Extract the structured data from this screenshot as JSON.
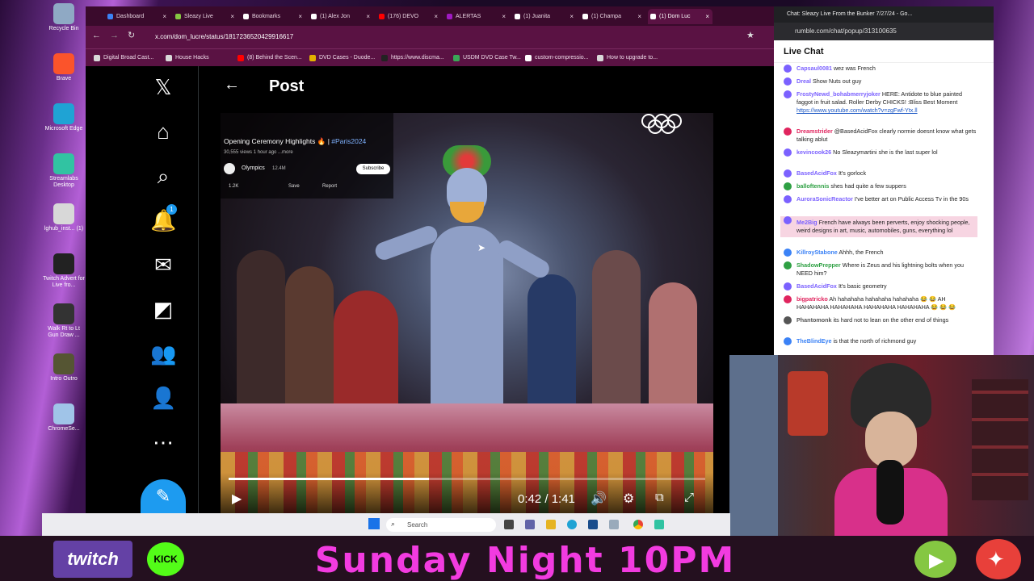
{
  "desktop_icons": [
    {
      "label": "Recycle Bin",
      "color": "#8fa9c4"
    },
    {
      "label": "Brave",
      "color": "#fb542b"
    },
    {
      "label": "Microsoft Edge",
      "color": "#1fa3d4"
    },
    {
      "label": "Streamlabs Desktop",
      "color": "#31c3a2"
    },
    {
      "label": "lghub_inst... (1)",
      "color": "#d8d8d8"
    },
    {
      "label": "Twitch Advert for Live fro...",
      "color": "#222"
    },
    {
      "label": "Walk Rt to Lt Gun Draw ...",
      "color": "#333"
    },
    {
      "label": "Intro Outro",
      "color": "#553"
    },
    {
      "label": "ChromeSe...",
      "color": "#a0c4e8"
    }
  ],
  "browser": {
    "tabs": [
      {
        "label": "Dashboard",
        "color": "#3b82f6"
      },
      {
        "label": "Sleazy Live",
        "color": "#85c742"
      },
      {
        "label": "Bookmarks",
        "color": "#ffffff"
      },
      {
        "label": "(1) Alex Jon",
        "color": "#ffffff"
      },
      {
        "label": "(176) DEVO",
        "color": "#ff0000"
      },
      {
        "label": "ALERTAS",
        "color": "#9f1ac2"
      },
      {
        "label": "(1) Juanita",
        "color": "#ffffff"
      },
      {
        "label": "(1) Champa",
        "color": "#ffffff"
      },
      {
        "label": "(1) Dom Luc",
        "color": "#ffffff"
      }
    ],
    "url": "x.com/dom_lucre/status/1817236520429916617",
    "bookmarks": [
      {
        "label": "Digital Broad Cast...",
        "color": "#d9d9d9"
      },
      {
        "label": "House Hacks",
        "color": "#d9d9d9"
      },
      {
        "label": "(8) Behind the Scen...",
        "color": "#ff0000"
      },
      {
        "label": "DVD Cases - Duode...",
        "color": "#e2b100"
      },
      {
        "label": "https://www.discma...",
        "color": "#222222"
      },
      {
        "label": "USDM DVD Case Tw...",
        "color": "#3aa757"
      },
      {
        "label": "custom-compressio...",
        "color": "#ffffff"
      },
      {
        "label": "How to upgrade to...",
        "color": "#d9d9d9"
      }
    ]
  },
  "x": {
    "nav": [
      "x-logo-icon",
      "home-icon",
      "search-icon",
      "notifications-icon",
      "messages-icon",
      "grok-icon",
      "communities-icon",
      "profile-icon",
      "more-icon"
    ],
    "notification_count": "1",
    "post_title": "Post",
    "video": {
      "title": "Opening Ceremony Highlights 🔥 | ",
      "hashtag": "#Paris2024",
      "meta": "30,555 views  1 hour ago  ...more",
      "channel": "Olympics",
      "subs": "12.4M",
      "subscribe": "Subscribe",
      "likes": "1.2K",
      "save": "Save",
      "report": "Report",
      "time": "0:42 / 1:41",
      "progress": 0.42
    }
  },
  "chat": {
    "window_title": "Chat: Sleazy Live From the Bunker 7/27/24 - Go...",
    "url": "rumble.com/chat/popup/313100635",
    "header": "Live Chat",
    "messages": [
      {
        "user": "Capsaul0081",
        "text": "wez was French",
        "color": "#7b61ff"
      },
      {
        "user": "Dreal",
        "text": "Show Nuts out guy",
        "color": "#7b61ff"
      },
      {
        "user": "FrostyNewd_bohabmerryjoker",
        "text": "HERE: Antidote to blue painted faggot in fruit salad. Roller Derby CHICKS! :Bliss Best Moment",
        "link": "https://www.youtube.com/watch?v=zgFwf-Ytx.ll",
        "color": "#7b61ff"
      },
      {
        "user": "Dreamstrider",
        "text": "@BasedAcidFox clearly normie doesnt know what gets talking ablut",
        "color": "#e0245e"
      },
      {
        "user": "kevincook26",
        "text": "No Sleazymartini she is the last super lol",
        "color": "#7b61ff"
      },
      {
        "user": "BasedAcidFox",
        "text": "It's gorlock",
        "color": "#7b61ff"
      },
      {
        "user": "balloftennis",
        "text": "shes had quite a few suppers",
        "color": "#2ea043"
      },
      {
        "user": "AuroraSonicReactor",
        "text": "I've better art on Public Access Tv in the 90s",
        "color": "#7b61ff"
      },
      {
        "user": "Me2Big",
        "text": "French have always been perverts, enjoy shocking people, weird designs in art, music, automobiles, guns, everything lol",
        "color": "#7b61ff",
        "highlight": true
      },
      {
        "user": "KillroyStabone",
        "text": "Ahhh, the French",
        "color": "#3b82f6"
      },
      {
        "user": "ShadowPrepper",
        "text": "Where is Zeus and his lightning bolts when you NEED him?",
        "color": "#2ea043"
      },
      {
        "user": "BasedAcidFox",
        "text": "It's basic geometry",
        "color": "#7b61ff"
      },
      {
        "user": "bigpatricko",
        "text": "Ah hahahaha hahahaha hahahaha 😂 😂 AH HAHAHAHA HAHAHAHA HAHAHAHA HAHAHAHA 😂 😂 😂",
        "color": "#e0245e"
      },
      {
        "user": "Phantomonk",
        "text": "its hard not to lean on the other end of things",
        "color": "#555555"
      },
      {
        "user": "TheBlindEye",
        "text": "is that the north of richmond guy",
        "color": "#3b82f6"
      }
    ]
  },
  "taskbar": {
    "search": "Search"
  },
  "banner": {
    "text": "Sunday Night 10PM",
    "twitch": "twitch",
    "kick": "KICK"
  }
}
